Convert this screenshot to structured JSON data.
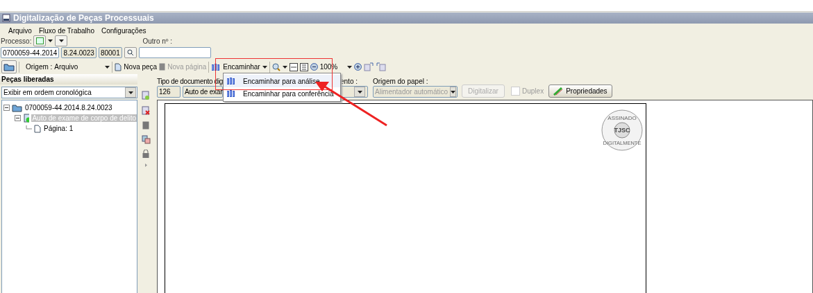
{
  "window": {
    "title": "Digitalização de Peças Processuais"
  },
  "menu": [
    "Arquivo",
    "Fluxo de Trabalho",
    "Configurações"
  ],
  "processo": {
    "label": "Processo:",
    "outro_label": "Outro nº :",
    "fields": [
      "0700059-44.2014",
      "8.24.0023",
      "80001"
    ]
  },
  "toolbar": {
    "origem_label": "Origem :",
    "origem_value": "Arquivo",
    "nova_peca": "Nova peça",
    "nova_pagina": "Nova página",
    "nova_pagina_disabled": true,
    "encaminhar": "Encaminhar",
    "zoom_value": "100%"
  },
  "encaminhar_menu": [
    {
      "label": "Encaminhar para análise",
      "selected": true
    },
    {
      "label": "Encaminhar para conferência",
      "selected": false
    }
  ],
  "left_panel": {
    "title": "Peças liberadas",
    "order": "Exibir em ordem cronológica",
    "tree": [
      {
        "label": "0700059-44.2014.8.24.0023",
        "kind": "process",
        "expanded": true,
        "selected": false,
        "children": [
          {
            "label": "Auto de exame de corpo de delito",
            "kind": "piece",
            "expanded": true,
            "selected": true,
            "children": [
              {
                "label": "Página: 1",
                "kind": "page",
                "selected": false
              }
            ]
          }
        ]
      }
    ]
  },
  "doc_form": {
    "tipo_label": "Tipo de documento dig",
    "tipo_code": "126",
    "tipo_name": "Auto de exar",
    "ento_label": "ento :",
    "origem_papel_label": "Origem do papel :",
    "origem_papel_value": "Alimentador automático",
    "origem_papel_disabled": true,
    "digitalizar": "Digitalizar",
    "digitalizar_disabled": true,
    "duplex": {
      "label": "Duplex",
      "checked": false,
      "disabled": true
    },
    "propriedades": "Propriedades"
  },
  "stamp": {
    "top": "ASSINADO",
    "center": "TJSC",
    "bottom": "DIGITALMENTE"
  }
}
